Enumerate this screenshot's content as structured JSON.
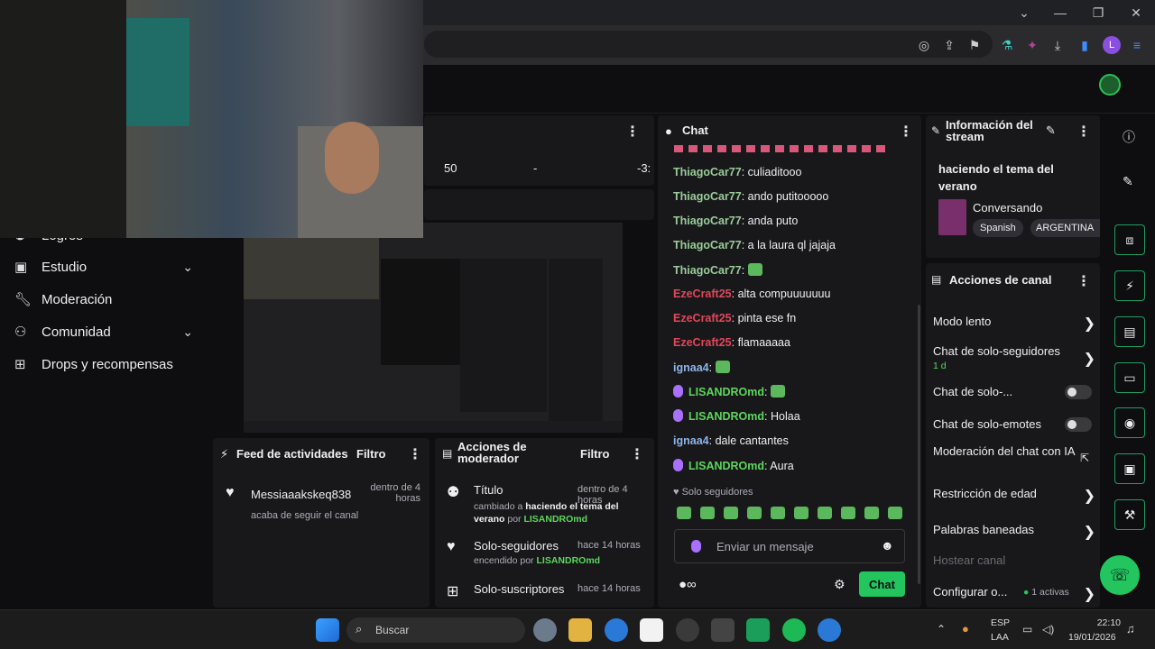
{
  "browser": {
    "window_controls": [
      "⌄",
      "—",
      "❐",
      "✕"
    ]
  },
  "nav": {
    "items": [
      {
        "icon": "trophy-icon",
        "label": "Logros"
      },
      {
        "icon": "studio-icon",
        "label": "Estudio"
      },
      {
        "icon": "wrench-icon",
        "label": "Moderación"
      },
      {
        "icon": "community-icon",
        "label": "Comunidad"
      },
      {
        "icon": "gift-icon",
        "label": "Drops y recompensas"
      }
    ]
  },
  "stats": {
    "value_a": "50",
    "sep": "-",
    "value_b": "-3:"
  },
  "activity_feed": {
    "title": "Feed de actividades",
    "filter": "Filtro",
    "item": {
      "name": "Messiaaakskeq838",
      "time": "dentro de 4 horas",
      "desc": "acaba de seguir el canal"
    }
  },
  "mod_actions": {
    "title": "Acciones de moderador",
    "filter": "Filtro",
    "items": [
      {
        "title": "Título",
        "time": "dentro de 4 horas",
        "line1": "cambiado a",
        "bold": "haciendo el tema del verano",
        "by": "por",
        "user": "LISANDROmd"
      },
      {
        "title": "Solo-seguidores",
        "time": "hace 14 horas",
        "line1": "encendido por",
        "user": "LISANDROmd"
      },
      {
        "title": "Solo-suscriptores",
        "time": "hace 14 horas"
      }
    ]
  },
  "chat": {
    "title": "Chat",
    "messages": [
      {
        "user": "ThiagoCar77",
        "color": "#9acd9a",
        "text": "culiaditooo"
      },
      {
        "user": "ThiagoCar77",
        "color": "#9acd9a",
        "text": "ando putitooooo"
      },
      {
        "user": "ThiagoCar77",
        "color": "#9acd9a",
        "text": "anda puto"
      },
      {
        "user": "ThiagoCar77",
        "color": "#9acd9a",
        "text": "a la laura ql jajaja"
      },
      {
        "user": "ThiagoCar77",
        "color": "#9acd9a",
        "text": ""
      },
      {
        "user": "EzeCraft25",
        "color": "#e0475b",
        "text": "alta compuuuuuuu"
      },
      {
        "user": "EzeCraft25",
        "color": "#e0475b",
        "text": "pinta ese fn"
      },
      {
        "user": "EzeCraft25",
        "color": "#e0475b",
        "text": "flamaaaaa"
      },
      {
        "user": "ignaa4",
        "color": "#8fb3e8",
        "text": ""
      },
      {
        "user": "LISANDROmd",
        "color": "#5cd65c",
        "text": ""
      },
      {
        "user": "LISANDROmd",
        "color": "#5cd65c",
        "text": "Holaa"
      },
      {
        "user": "ignaa4",
        "color": "#8fb3e8",
        "text": "dale cantantes"
      },
      {
        "user": "LISANDROmd",
        "color": "#5cd65c",
        "text": "Aura"
      }
    ],
    "followers_only": "Solo seguidores",
    "input_placeholder": "Enviar un mensaje",
    "send_label": "Chat"
  },
  "stream_info": {
    "title": "Información del stream",
    "stream_title": "haciendo el tema del verano",
    "category": "Conversando",
    "tags": [
      "Spanish",
      "ARGENTINA"
    ]
  },
  "channel_actions": {
    "title": "Acciones de canal",
    "slow_mode": "Modo lento",
    "followers_chat": "Chat de solo-seguidores",
    "followers_chat_value": "1 d",
    "subs_chat": "Chat de solo-...",
    "emotes_chat": "Chat de solo-emotes",
    "ai_mod": "Moderación del chat con IA",
    "age": "Restricción de edad",
    "banned_words": "Palabras baneadas",
    "host": "Hostear canal",
    "goals": "Configurar o...",
    "goals_active": "1 activas"
  },
  "taskbar": {
    "search": "Buscar",
    "lang": "ESP",
    "layout": "LAA",
    "time": "22:10",
    "date": "19/01/2026"
  }
}
